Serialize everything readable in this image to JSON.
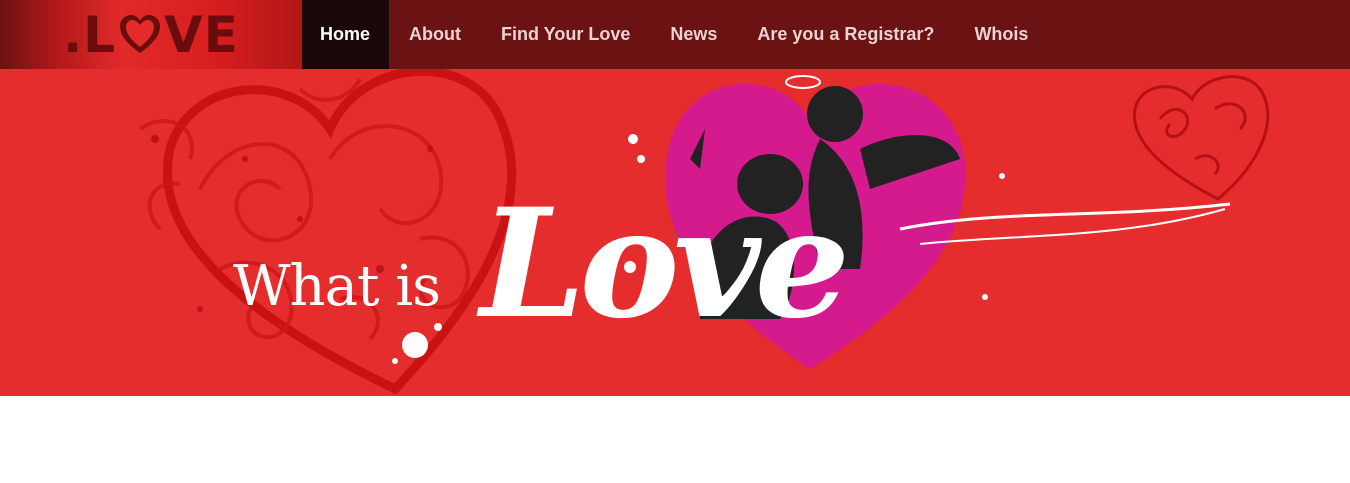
{
  "brand": {
    "logo_text_prefix": ".L",
    "logo_text_suffix": "VE",
    "logo_alt": ".LOVE"
  },
  "nav": {
    "items": [
      {
        "label": "Home",
        "active": true
      },
      {
        "label": "About",
        "active": false
      },
      {
        "label": "Find Your Love",
        "active": false
      },
      {
        "label": "News",
        "active": false
      },
      {
        "label": "Are you a Registrar?",
        "active": false
      },
      {
        "label": "Whois",
        "active": false
      }
    ]
  },
  "hero": {
    "heading": "What is",
    "highlight": "Love"
  },
  "colors": {
    "navbar_bg": "#6b1212",
    "nav_active_bg": "#1a0707",
    "hero_bg": "#e52d2d",
    "heart_pink": "#d41a8c",
    "silhouette": "#222222"
  },
  "icons": {
    "logo_heart": "heart-icon",
    "hero_pink_heart": "heart-icon",
    "swirl_heart": "heart-icon"
  }
}
